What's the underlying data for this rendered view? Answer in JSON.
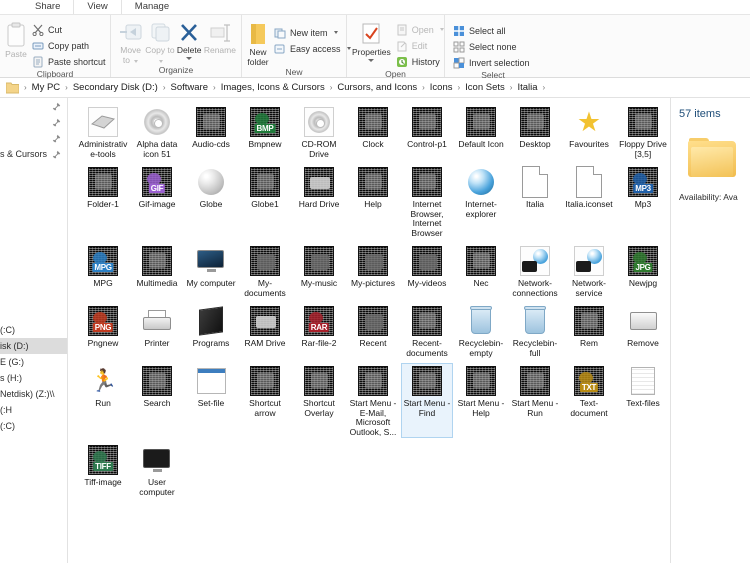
{
  "ribbon_tabs": [
    {
      "label": "Share"
    },
    {
      "label": "View"
    },
    {
      "label": "Manage"
    }
  ],
  "ribbon": {
    "groups": [
      {
        "name": "clipboard",
        "label": "Clipboard",
        "big": [
          {
            "label": "Paste",
            "icon": "clipboard-icon",
            "disabled": true
          }
        ],
        "small": [
          {
            "label": "Cut",
            "icon": "scissors-icon",
            "disabled": false
          },
          {
            "label": "Copy path",
            "icon": "copy-path-icon",
            "disabled": false
          },
          {
            "label": "Paste shortcut",
            "icon": "paste-shortcut-icon",
            "disabled": false
          }
        ]
      },
      {
        "name": "organize",
        "label": "Organize",
        "big": [
          {
            "label": "Move to",
            "icon": "move-to-icon",
            "disabled": true,
            "caret": true
          },
          {
            "label": "Copy to",
            "icon": "copy-to-icon",
            "disabled": true,
            "caret": true
          },
          {
            "label": "Delete",
            "icon": "delete-x-icon",
            "disabled": false,
            "caret": true
          },
          {
            "label": "Rename",
            "icon": "rename-icon",
            "disabled": true
          }
        ]
      },
      {
        "name": "new",
        "label": "New",
        "big": [
          {
            "label": "New folder",
            "icon": "new-folder-icon",
            "disabled": false
          }
        ],
        "small": [
          {
            "label": "New item",
            "icon": "new-item-icon",
            "caret": true
          },
          {
            "label": "Easy access",
            "icon": "easy-access-icon",
            "caret": true
          }
        ]
      },
      {
        "name": "open",
        "label": "Open",
        "big": [
          {
            "label": "Properties",
            "icon": "properties-icon",
            "disabled": false,
            "caret": true
          }
        ],
        "small": [
          {
            "label": "Open",
            "icon": "open-icon",
            "disabled": true,
            "caret": true
          },
          {
            "label": "Edit",
            "icon": "edit-icon",
            "disabled": true
          },
          {
            "label": "History",
            "icon": "history-icon",
            "disabled": false
          }
        ]
      },
      {
        "name": "select",
        "label": "Select",
        "small": [
          {
            "label": "Select all",
            "icon": "select-all-icon"
          },
          {
            "label": "Select none",
            "icon": "select-none-icon"
          },
          {
            "label": "Invert selection",
            "icon": "invert-selection-icon"
          }
        ]
      }
    ]
  },
  "breadcrumb": [
    "My PC",
    "Secondary Disk (D:)",
    "Software",
    "Images, Icons & Cursors",
    "Cursors, and Icons",
    "Icons",
    "Icon Sets",
    "Italia"
  ],
  "nav_pane": {
    "items": [
      {
        "label": "",
        "pin": true,
        "selected": false
      },
      {
        "label": "",
        "pin": true,
        "selected": false
      },
      {
        "label": "",
        "pin": true,
        "selected": false
      },
      {
        "label": "s & Cursors",
        "pin": true,
        "selected": false
      },
      {
        "label": "",
        "pin": false,
        "selected": false
      },
      {
        "label": "",
        "pin": false,
        "selected": false
      },
      {
        "label": "",
        "pin": false,
        "selected": false
      },
      {
        "label": "",
        "pin": false,
        "selected": false
      },
      {
        "label": "",
        "pin": false,
        "selected": false
      },
      {
        "label": "",
        "pin": false,
        "selected": false
      },
      {
        "label": "",
        "pin": false,
        "selected": false
      },
      {
        "label": "",
        "pin": false,
        "selected": false
      },
      {
        "label": "",
        "pin": false,
        "selected": false
      },
      {
        "label": "",
        "pin": false,
        "selected": false
      },
      {
        "label": "(C:)",
        "pin": false,
        "selected": false
      },
      {
        "label": "isk (D:)",
        "pin": false,
        "selected": true
      },
      {
        "label": "E (G:)",
        "pin": false,
        "selected": false
      },
      {
        "label": "s (H:)",
        "pin": false,
        "selected": false
      },
      {
        "label": "\\\\Netdisk) (Z:)",
        "pin": false,
        "selected": false
      },
      {
        "label": "H:)",
        "pin": false,
        "selected": false
      },
      {
        "label": "(C:)",
        "pin": false,
        "selected": false
      }
    ]
  },
  "details": {
    "item_count": "57 items",
    "folder_icon": "folder-icon",
    "availability_label": "Availability:",
    "availability_value": "Ava"
  },
  "files": [
    {
      "label": "Administrative-tools",
      "icon": "gray-device-icon"
    },
    {
      "label": "Alpha data icon 51",
      "icon": "cd-disc-icon"
    },
    {
      "label": "Audio-cds",
      "icon": "noise-disc-icon"
    },
    {
      "label": "Bmpnew",
      "icon": "bmp-icon",
      "tag": "BMP"
    },
    {
      "label": "CD-ROM Drive",
      "icon": "cdrom-icon"
    },
    {
      "label": "Clock",
      "icon": "clock-icon"
    },
    {
      "label": "Control-p1",
      "icon": "control-panel-icon"
    },
    {
      "label": "Default Icon",
      "icon": "default-icon"
    },
    {
      "label": "Desktop",
      "icon": "desktop-icon"
    },
    {
      "label": "Favourites",
      "icon": "star-icon"
    },
    {
      "label": "Floppy Drive [3,5]",
      "icon": "floppy-icon"
    },
    {
      "label": "Folder-1",
      "icon": "folder-noise-icon"
    },
    {
      "label": "Gif-image",
      "icon": "gif-icon",
      "tag": "GIF"
    },
    {
      "label": "Globe",
      "icon": "globe-gray-icon"
    },
    {
      "label": "Globe1",
      "icon": "globe-noise-icon"
    },
    {
      "label": "Hard Drive",
      "icon": "harddrive-icon"
    },
    {
      "label": "Help",
      "icon": "help-icon"
    },
    {
      "label": "Internet Browser, Internet Browser",
      "icon": "internet-browser-icon"
    },
    {
      "label": "Internet-explorer",
      "icon": "internet-explorer-icon"
    },
    {
      "label": "Italia",
      "icon": "blank-doc-icon"
    },
    {
      "label": "Italia.iconset",
      "icon": "blank-doc-icon"
    },
    {
      "label": "Mp3",
      "icon": "mp3-icon",
      "tag": "MP3"
    },
    {
      "label": "MPG",
      "icon": "mpg-icon",
      "tag": "MPG"
    },
    {
      "label": "Multimedia",
      "icon": "multimedia-icon"
    },
    {
      "label": "My computer",
      "icon": "my-computer-icon"
    },
    {
      "label": "My-documents",
      "icon": "my-documents-icon"
    },
    {
      "label": "My-music",
      "icon": "my-music-icon"
    },
    {
      "label": "My-pictures",
      "icon": "my-pictures-icon"
    },
    {
      "label": "My-videos",
      "icon": "my-videos-icon"
    },
    {
      "label": "Nec",
      "icon": "nec-icon"
    },
    {
      "label": "Network-connections",
      "icon": "network-connections-icon"
    },
    {
      "label": "Network-service",
      "icon": "network-service-icon"
    },
    {
      "label": "Newjpg",
      "icon": "jpg-icon",
      "tag": "JPG"
    },
    {
      "label": "Pngnew",
      "icon": "png-icon",
      "tag": "PNG"
    },
    {
      "label": "Printer",
      "icon": "printer-icon"
    },
    {
      "label": "Programs",
      "icon": "programs-icon"
    },
    {
      "label": "RAM Drive",
      "icon": "ram-drive-icon"
    },
    {
      "label": "Rar-file-2",
      "icon": "rar-icon",
      "tag": "RAR"
    },
    {
      "label": "Recent",
      "icon": "recent-icon"
    },
    {
      "label": "Recent-documents",
      "icon": "recent-documents-icon"
    },
    {
      "label": "Recyclebin-empty",
      "icon": "recyclebin-empty-icon"
    },
    {
      "label": "Recyclebin-full",
      "icon": "recyclebin-full-icon"
    },
    {
      "label": "Rem",
      "icon": "rem-icon"
    },
    {
      "label": "Remove",
      "icon": "remove-icon"
    },
    {
      "label": "Run",
      "icon": "run-icon"
    },
    {
      "label": "Search",
      "icon": "search-icon"
    },
    {
      "label": "Set-file",
      "icon": "set-file-icon"
    },
    {
      "label": "Shortcut arrow",
      "icon": "shortcut-arrow-icon"
    },
    {
      "label": "Shortcut Overlay",
      "icon": "shortcut-overlay-icon"
    },
    {
      "label": "Start Menu - E-Mail, Microsoft Outlook, S...",
      "icon": "start-menu-email-icon"
    },
    {
      "label": "Start Menu - Find",
      "icon": "start-menu-find-icon",
      "selected": true
    },
    {
      "label": "Start Menu - Help",
      "icon": "start-menu-help-icon"
    },
    {
      "label": "Start Menu - Run",
      "icon": "start-menu-run-icon"
    },
    {
      "label": "Text-document",
      "icon": "txt-icon",
      "tag": "TXT"
    },
    {
      "label": "Text-files",
      "icon": "text-files-icon"
    },
    {
      "label": "Tiff-image",
      "icon": "tiff-icon",
      "tag": "TIFF"
    },
    {
      "label": "User computer",
      "icon": "user-computer-icon"
    }
  ]
}
